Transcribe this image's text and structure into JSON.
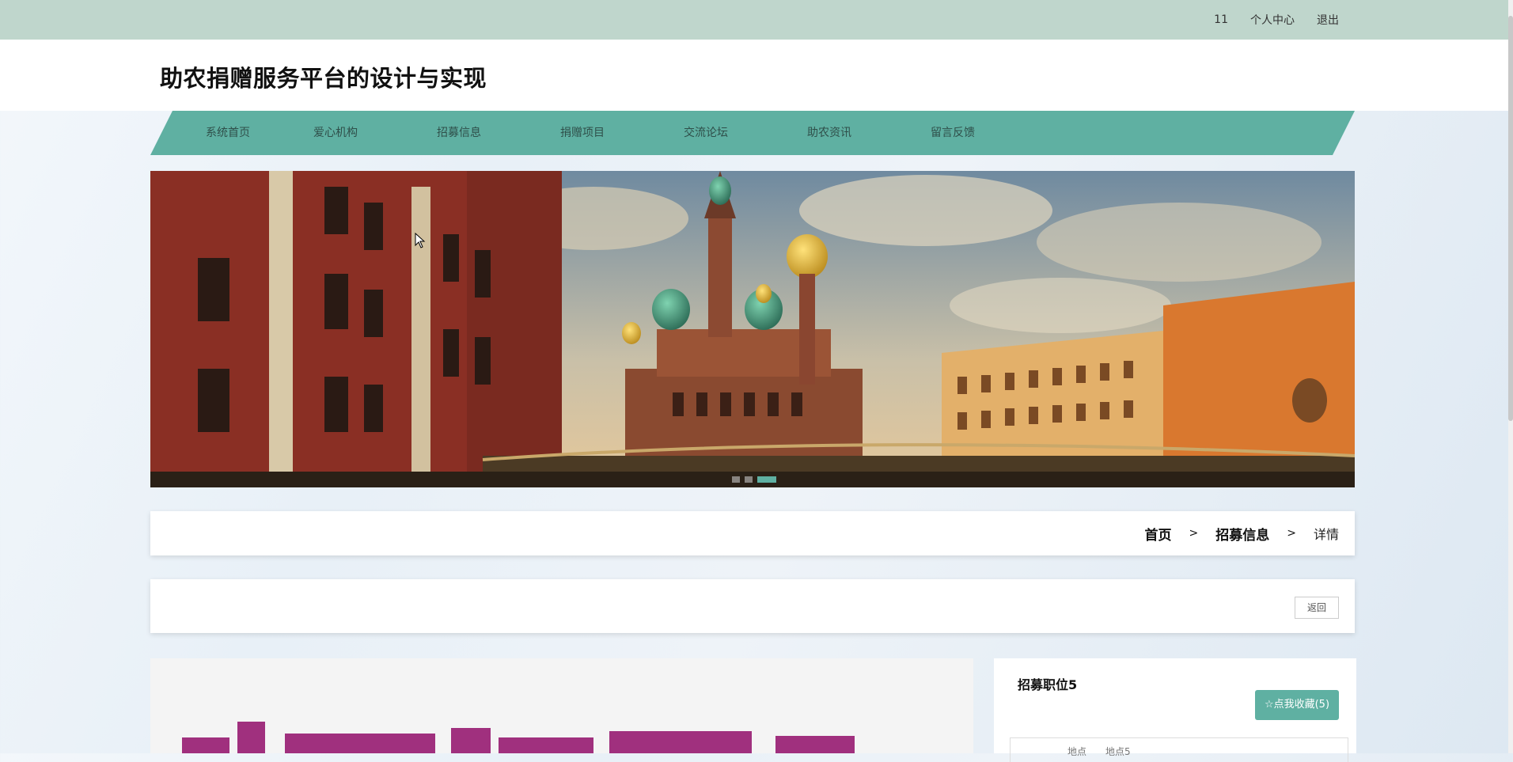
{
  "topbar": {
    "username": "11",
    "profile_label": "个人中心",
    "logout_label": "退出"
  },
  "header": {
    "title": "助农捐赠服务平台的设计与实现"
  },
  "nav": {
    "items": [
      {
        "label": "系统首页"
      },
      {
        "label": "爱心机构"
      },
      {
        "label": "招募信息"
      },
      {
        "label": "捐赠项目"
      },
      {
        "label": "交流论坛"
      },
      {
        "label": "助农资讯"
      },
      {
        "label": "留言反馈"
      }
    ]
  },
  "banner": {
    "slide_count": 3,
    "active_slide": 3
  },
  "breadcrumb": {
    "home": "首页",
    "section": "招募信息",
    "current": "详情",
    "separator": ">"
  },
  "backbar": {
    "back_label": "返回"
  },
  "detail": {
    "title": "招募职位5",
    "favorite_label": "☆点我收藏(5)",
    "info_label": "地点",
    "info_value": "地点5"
  },
  "colors": {
    "accent": "#5fb0a2",
    "topbar": "#bfd6cc"
  }
}
